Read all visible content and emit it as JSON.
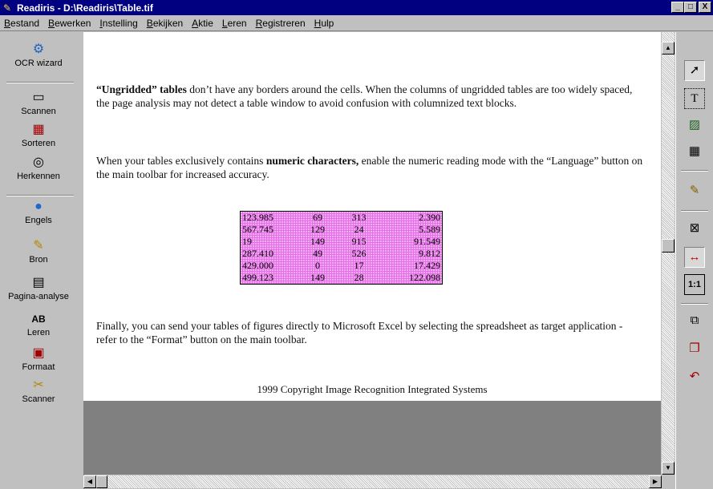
{
  "window": {
    "title": "Readiris - D:\\Readiris\\Table.tif",
    "controls": [
      "_",
      "□",
      "X"
    ]
  },
  "menu": [
    "Bestand",
    "Bewerken",
    "Instelling",
    "Bekijken",
    "Aktie",
    "Leren",
    "Registreren",
    "Hulp"
  ],
  "left_toolbar": {
    "ocr_wizard": "OCR wizard",
    "scan": "Scannen",
    "sort": "Sorteren",
    "recognize": "Herkennen",
    "language": "Engels",
    "source": "Bron",
    "page_analysis": "Pagina-analyse",
    "learn": "Leren",
    "format": "Formaat",
    "scanner": "Scanner"
  },
  "document": {
    "p1_bold": "“Ungridded” tables",
    "p1_rest": " don’t have any borders around the cells. When the columns of ungridded tables are too widely spaced, the page analysis may not detect a table window to avoid confusion with columnized text blocks.",
    "p2_start": "When your tables exclusively contains ",
    "p2_bold": "numeric characters,",
    "p2_rest": " enable the numeric reading mode with the “Language” button on the main toolbar for increased accuracy.",
    "table": [
      [
        "123.985",
        "69",
        "313",
        "2.390"
      ],
      [
        "567.745",
        "129",
        "24",
        "5.589"
      ],
      [
        "19",
        "149",
        "915",
        "91.549"
      ],
      [
        "287.410",
        "49",
        "526",
        "9.812"
      ],
      [
        "429.000",
        "0",
        "17",
        "17.429"
      ],
      [
        "499.123",
        "149",
        "28",
        "122.098"
      ]
    ],
    "p3": "Finally, you can send your tables of figures directly to Microsoft Excel by selecting the spreadsheet as target application - refer to the “Format” button on the main toolbar.",
    "copyright": "1999 Copyright Image Recognition Integrated Systems"
  },
  "right_toolbar": [
    "select-arrow-icon",
    "text-zone-icon",
    "graphic-zone-icon",
    "table-zone-icon",
    "zone-properties-icon",
    "zoom-fit-icon",
    "fit-width-icon",
    "zoom-1-1-icon",
    "order-zones-icon",
    "copy-zones-icon",
    "delete-zones-icon"
  ],
  "right_toolbar_labels": {
    "zoom_1_1": "1:1",
    "text_zone": "T"
  }
}
